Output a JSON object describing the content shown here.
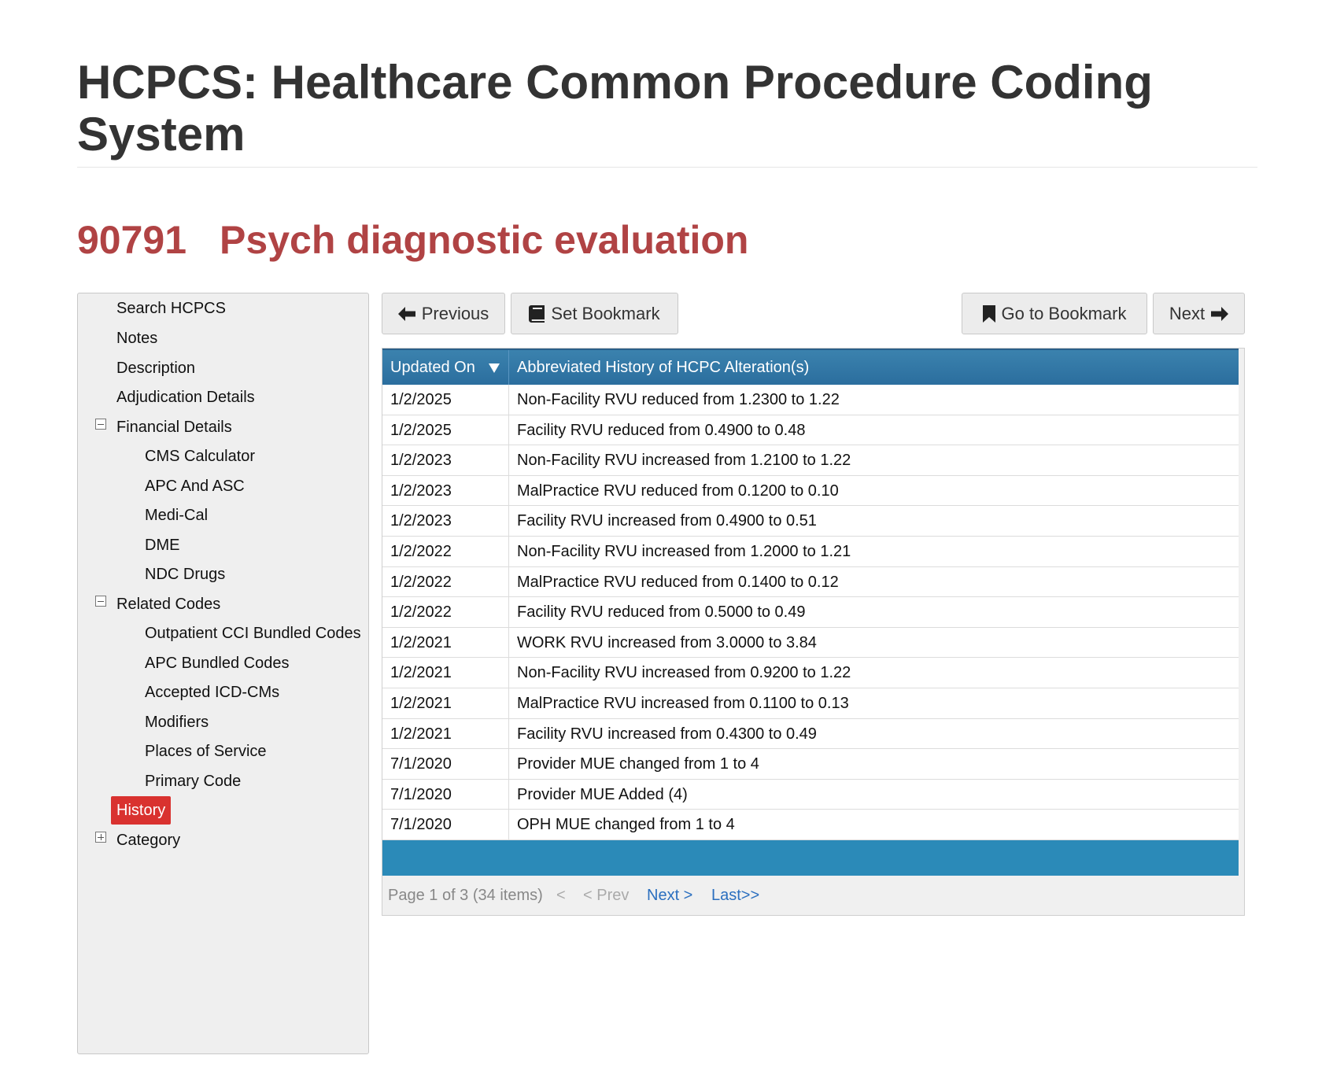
{
  "page": {
    "title": "HCPCS: Healthcare Common Procedure Coding System",
    "code": "90791",
    "code_title": "Psych diagnostic evaluation"
  },
  "sidebar": {
    "items": [
      {
        "label": "Search HCPCS"
      },
      {
        "label": "Notes"
      },
      {
        "label": "Description"
      },
      {
        "label": "Adjudication Details"
      },
      {
        "label": "Financial Details",
        "expanded": true
      },
      {
        "label": "CMS Calculator"
      },
      {
        "label": "APC And ASC"
      },
      {
        "label": "Medi-Cal"
      },
      {
        "label": "DME"
      },
      {
        "label": "NDC Drugs"
      },
      {
        "label": "Related Codes",
        "expanded": true
      },
      {
        "label": "Outpatient CCI Bundled Codes"
      },
      {
        "label": "APC Bundled Codes"
      },
      {
        "label": "Accepted ICD-CMs"
      },
      {
        "label": "Modifiers"
      },
      {
        "label": "Places of Service"
      },
      {
        "label": "Primary Code"
      },
      {
        "label": "History",
        "active": true
      },
      {
        "label": "Category",
        "expanded": false
      }
    ]
  },
  "toolbar": {
    "previous_label": "Previous",
    "set_bookmark_label": "Set Bookmark",
    "go_to_bookmark_label": "Go to Bookmark",
    "next_label": "Next"
  },
  "table": {
    "columns": [
      "Updated On",
      "Abbreviated History of HCPC Alteration(s)"
    ],
    "rows": [
      [
        "1/2/2025",
        "Non-Facility RVU reduced from 1.2300 to 1.22"
      ],
      [
        "1/2/2025",
        "Facility RVU reduced from 0.4900 to 0.48"
      ],
      [
        "1/2/2023",
        "Non-Facility RVU increased from 1.2100 to 1.22"
      ],
      [
        "1/2/2023",
        "MalPractice RVU reduced from 0.1200 to 0.10"
      ],
      [
        "1/2/2023",
        "Facility RVU increased from 0.4900 to 0.51"
      ],
      [
        "1/2/2022",
        "Non-Facility RVU increased from 1.2000 to 1.21"
      ],
      [
        "1/2/2022",
        "MalPractice RVU reduced from 0.1400 to 0.12"
      ],
      [
        "1/2/2022",
        "Facility RVU reduced from 0.5000 to 0.49"
      ],
      [
        "1/2/2021",
        "WORK RVU increased from 3.0000 to 3.84"
      ],
      [
        "1/2/2021",
        "Non-Facility RVU increased from 0.9200 to 1.22"
      ],
      [
        "1/2/2021",
        "MalPractice RVU increased from 0.1100 to 0.13"
      ],
      [
        "1/2/2021",
        "Facility RVU increased from 0.4300 to 0.49"
      ],
      [
        "7/1/2020",
        "Provider MUE changed from 1 to 4"
      ],
      [
        "7/1/2020",
        "Provider MUE Added (4)"
      ],
      [
        "7/1/2020",
        "OPH MUE changed from 1 to 4"
      ]
    ]
  },
  "pager": {
    "info": "Page 1 of 3 (34 items)",
    "first": "<",
    "prev": "< Prev",
    "next": "Next >",
    "last": "Last>>"
  },
  "colors": {
    "accent_red": "#b04344",
    "active_nav": "#d9322f",
    "header_blue": "#2b6e9e",
    "footer_blue": "#2b8ab8",
    "link_blue": "#2b6fbf"
  },
  "icons": {
    "previous": "arrow-left-icon",
    "set_bookmark": "book-icon",
    "go_to_bookmark": "bookmark-icon",
    "next": "arrow-right-icon",
    "sort": "caret-down-icon",
    "expanded_toggle": "minus-square-icon",
    "collapsed_toggle": "plus-square-icon"
  }
}
